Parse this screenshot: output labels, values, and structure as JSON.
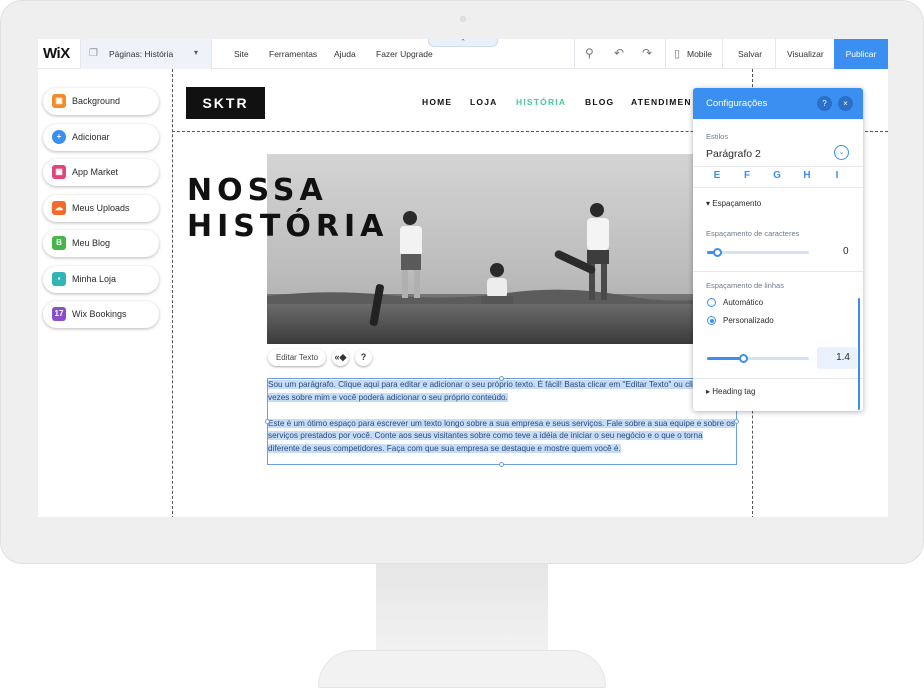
{
  "app": {
    "logo": "WiX"
  },
  "topbar": {
    "pages_label": "Páginas: História",
    "site": "Site",
    "tools": "Ferramentas",
    "help": "Ajuda",
    "upgrade": "Fazer Upgrade",
    "mobile": "Mobile",
    "save": "Salvar",
    "preview": "Visualizar",
    "publish": "Publicar"
  },
  "left_panel": {
    "items": [
      {
        "label": "Background",
        "color": "#f28c28",
        "icon": "background-icon"
      },
      {
        "label": "Adicionar",
        "color": "#3b8ff0",
        "icon": "add-icon"
      },
      {
        "label": "App Market",
        "color": "#e1457a",
        "icon": "app-market-icon"
      },
      {
        "label": "Meus Uploads",
        "color": "#f26b2b",
        "icon": "upload-cloud-icon"
      },
      {
        "label": "Meu Blog",
        "color": "#45b649",
        "icon": "blog-icon"
      },
      {
        "label": "Minha Loja",
        "color": "#2fb5b5",
        "icon": "store-bag-icon"
      },
      {
        "label": "Wix Bookings",
        "color": "#8a4fc8",
        "icon": "calendar-icon"
      }
    ]
  },
  "site": {
    "logo": "SKTR",
    "nav": [
      "HOME",
      "LOJA",
      "HISTÓRIA",
      "BLOG",
      "ATENDIMEN"
    ],
    "nav_active_color": "#4bc5a0",
    "headline_line1": "NOSSA",
    "headline_line2": "HISTÓRIA",
    "edit_text_button": "Editar Texto",
    "paragraph1": "Sou um parágrafo. Clique aqui para editar e adicionar o seu próprio texto. É fácil! Basta clicar em \"Editar Texto\" ou clicar duas vezes sobre mim e você poderá adicionar o seu próprio conteúdo.",
    "paragraph2": "Este é um ótimo espaço para escrever um texto longo sobre a sua empresa e seus serviços. Fale sobre a sua equipe e sobre os serviços prestados por você. Conte aos seus visitantes sobre como teve a idéia de iniciar o seu negócio e o que o torna diferente de seus competidores. Faça com que sua empresa se destaque e mostre quem você é."
  },
  "settings_panel": {
    "title": "Configurações",
    "help": "?",
    "close": "×",
    "styles_label": "Estilos",
    "style_value": "Parágrafo 2",
    "spacing_section": "Espaçamento",
    "char_spacing_label": "Espaçamento de caracteres",
    "char_spacing_value": "0",
    "char_spacing_level": 0.1,
    "line_spacing_label": "Espaçamento de linhas",
    "option_auto": "Automático",
    "option_custom": "Personalizado",
    "line_spacing_value": "1.4",
    "line_spacing_level": 0.35,
    "heading_tag_section": "Heading tag",
    "accent_color": "#3b8ff0"
  }
}
